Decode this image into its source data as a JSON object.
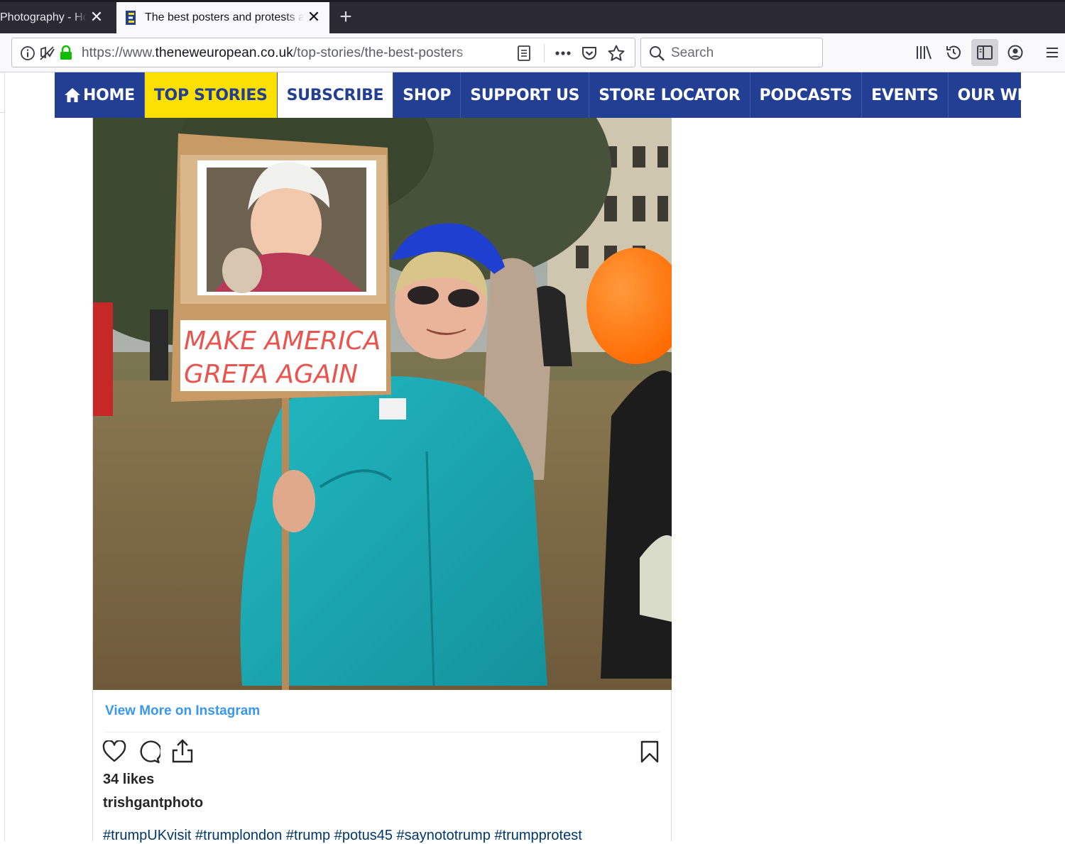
{
  "browser": {
    "tabs": [
      {
        "title": "Photography - Home"
      },
      {
        "title": "The best posters and protests at Trump's visit"
      }
    ],
    "url_prefix": "https://www.",
    "url_domain": "theneweuropean.co.uk",
    "url_path": "/top-stories/the-best-posters",
    "search_placeholder": "Search"
  },
  "site_nav": {
    "items": [
      "HOME",
      "TOP STORIES",
      "SUBSCRIBE",
      "SHOP",
      "SUPPORT US",
      "STORE LOCATOR",
      "PODCASTS",
      "EVENTS",
      "OUR WRITERS"
    ]
  },
  "post": {
    "sign_line1": "MAKE AMERICA",
    "sign_line2": "GRETA AGAIN",
    "view_more": "View More on Instagram",
    "likes": "34 likes",
    "username": "trishgantphoto",
    "hashtags": "#trumpUKvisit #trumplondon #trump #potus45 #saynototrump #trumpprotest"
  },
  "colors": {
    "nav_bg": "#233f94",
    "nav_highlight": "#fde003",
    "instagram_link": "#3897f0"
  }
}
